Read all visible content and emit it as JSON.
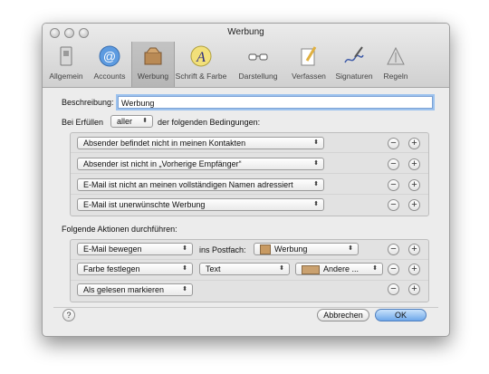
{
  "window": {
    "title": "Werbung"
  },
  "toolbar": {
    "items": [
      {
        "label": "Allgemein",
        "icon": "switch-icon"
      },
      {
        "label": "Accounts",
        "icon": "at-sign-icon"
      },
      {
        "label": "Werbung",
        "icon": "junk-mailbox-icon"
      },
      {
        "label": "Schrift & Farbe",
        "icon": "font-color-icon"
      },
      {
        "label": "Darstellung",
        "icon": "glasses-icon"
      },
      {
        "label": "Verfassen",
        "icon": "pencil-paper-icon"
      },
      {
        "label": "Signaturen",
        "icon": "signature-pen-icon"
      },
      {
        "label": "Regeln",
        "icon": "rules-icon"
      }
    ],
    "selected": "Werbung"
  },
  "form": {
    "description_label": "Beschreibung:",
    "description_value": "Werbung",
    "condition_prefix": "Bei Erfüllen",
    "condition_mode": "aller",
    "condition_suffix": "der folgenden Bedingungen:",
    "conditions": [
      "Absender befindet nicht in meinen Kontakten",
      "Absender ist nicht in „Vorherige Empfänger“",
      "E-Mail ist nicht an meinen vollständigen Namen adressiert",
      "E-Mail ist unerwünschte Werbung"
    ],
    "actions_label": "Folgende Aktionen durchführen:",
    "actions": [
      {
        "action": "E-Mail bewegen",
        "connector": "ins Postfach:",
        "target": "Werbung"
      },
      {
        "action": "Farbe festlegen",
        "option": "Text",
        "color_choice": "Andere ..."
      },
      {
        "action": "Als gelesen markieren"
      }
    ],
    "remove_symbol": "−",
    "add_symbol": "+"
  },
  "buttons": {
    "help": "?",
    "cancel": "Abbrechen",
    "ok": "OK"
  },
  "colors": {
    "accent": "#6ea8ea",
    "swatch": "#caa16f"
  }
}
